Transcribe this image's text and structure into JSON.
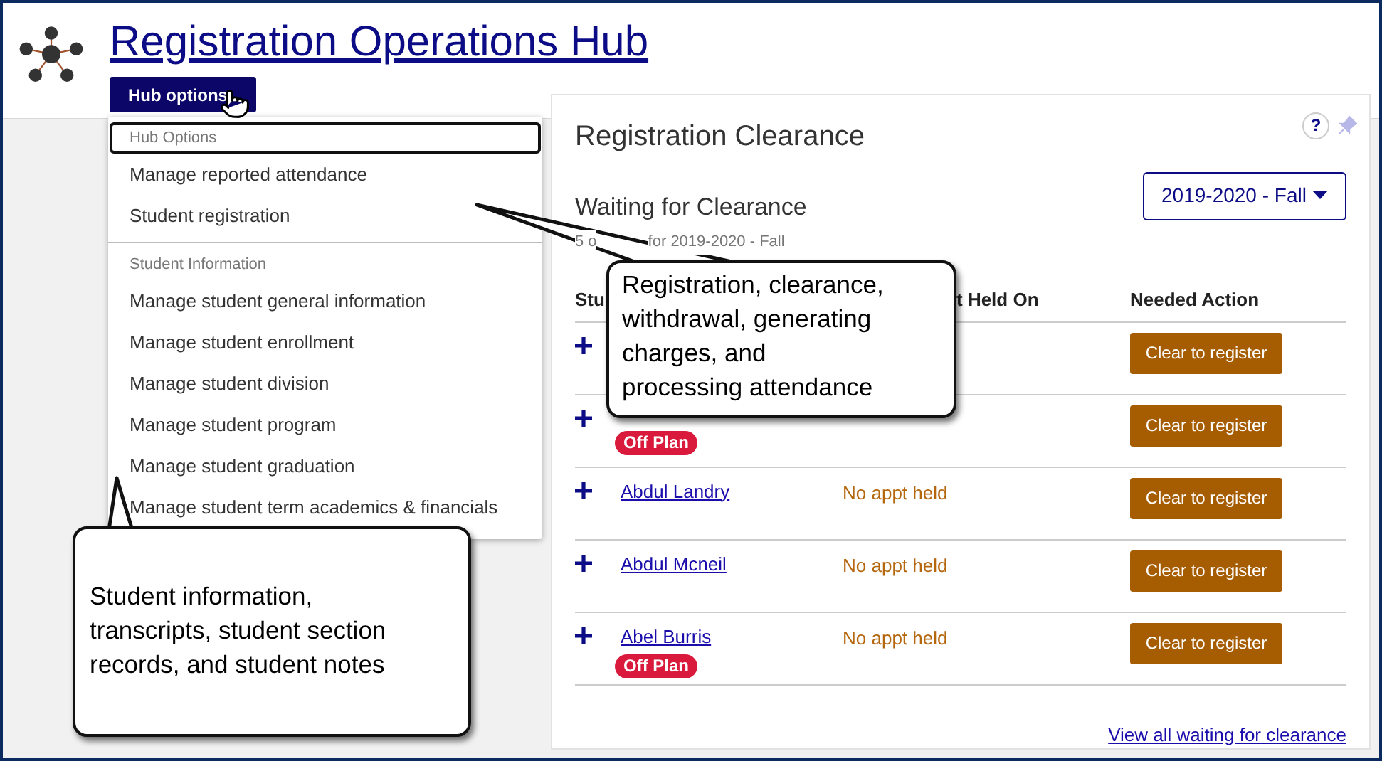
{
  "header": {
    "title": "Registration Operations Hub",
    "hub_button": "Hub options"
  },
  "hub_menu": {
    "sections": [
      {
        "heading": "Hub Options",
        "focused": true,
        "items": [
          "Manage reported attendance",
          "Student registration"
        ]
      },
      {
        "heading": "Student Information",
        "focused": false,
        "items": [
          "Manage student general information",
          "Manage student enrollment",
          "Manage student division",
          "Manage student program",
          "Manage student graduation",
          "Manage student term academics & financials"
        ]
      }
    ]
  },
  "panel": {
    "title": "Registration Clearance",
    "section_title": "Waiting for Clearance",
    "subtitle_parts": [
      "5 o",
      "for 2019-2020 - Fall"
    ],
    "term_select": "2019-2020 - Fall",
    "columns": [
      "Stu",
      "t Held On",
      "Needed Action"
    ],
    "rows": [
      {
        "action": "Clear to register"
      },
      {
        "badge": "Off Plan",
        "action": "Clear to register"
      },
      {
        "name": "Abdul Landry",
        "appointment": "No appt held",
        "action": "Clear to register"
      },
      {
        "name": "Abdul Mcneil",
        "appointment": "No appt held",
        "action": "Clear to register"
      },
      {
        "name": "Abel Burris",
        "badge": "Off Plan",
        "appointment": "No appt held",
        "action": "Clear to register"
      }
    ],
    "help_icon": "?",
    "footer_link": "View all waiting for clearance"
  },
  "callouts": [
    {
      "text": "Registration, clearance,\nwithdrawal, generating\ncharges, and\nprocessing attendance"
    },
    {
      "text": "Student information,\ntranscripts, student section\nrecords, and student notes"
    }
  ]
}
